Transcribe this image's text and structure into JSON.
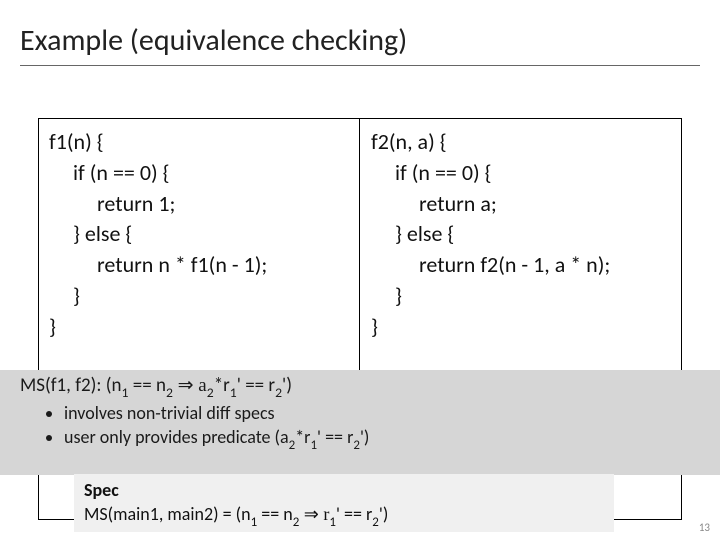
{
  "slide": {
    "title": "Example (equivalence checking)",
    "pageNumber": "13"
  },
  "codeLeft": {
    "l0": "f1(n) {",
    "l1": "if (n == 0) {",
    "l2": "return 1;",
    "l3": "} else {",
    "l4": "return n * f1(n - 1);",
    "l5": "}",
    "l6": "}"
  },
  "codeRight": {
    "l0": "f2(n, a) {",
    "l1": "if (n == 0) {",
    "l2": "return a;",
    "l3": "} else {",
    "l4": "return f2(n - 1, a * n);",
    "l5": "}",
    "l6": "}"
  },
  "overlay1": {
    "msPrefix": "MS(f1, f2): (n",
    "msSub1": "1",
    "msMid1": " == n",
    "msSub2": "2",
    "msImp": " ⇒ a",
    "msSubA": "2",
    "msR1": "*r",
    "msSubR1": "1",
    "msPrime1": "' == r",
    "msSubR2": "2",
    "msEnd": "')",
    "bullet1": "involves non-trivial diff specs",
    "bullet2a": "user only provides predicate (a",
    "bullet2sub": "2",
    "bullet2b": "*r",
    "bullet2sub2": "1",
    "bullet2c": "' == r",
    "bullet2sub3": "2",
    "bullet2d": "')"
  },
  "overlay2": {
    "spec": "Spec",
    "eqPrefix": "MS(main1, main2) = ",
    "eqN1": " (n",
    "eqSub1": "1",
    "eqMid": " == n",
    "eqSub2": "2",
    "eqImp": " ⇒ r",
    "eqSubR1": "1",
    "eqPrime1": "' == r",
    "eqSubR2": "2",
    "eqEnd": "')"
  }
}
